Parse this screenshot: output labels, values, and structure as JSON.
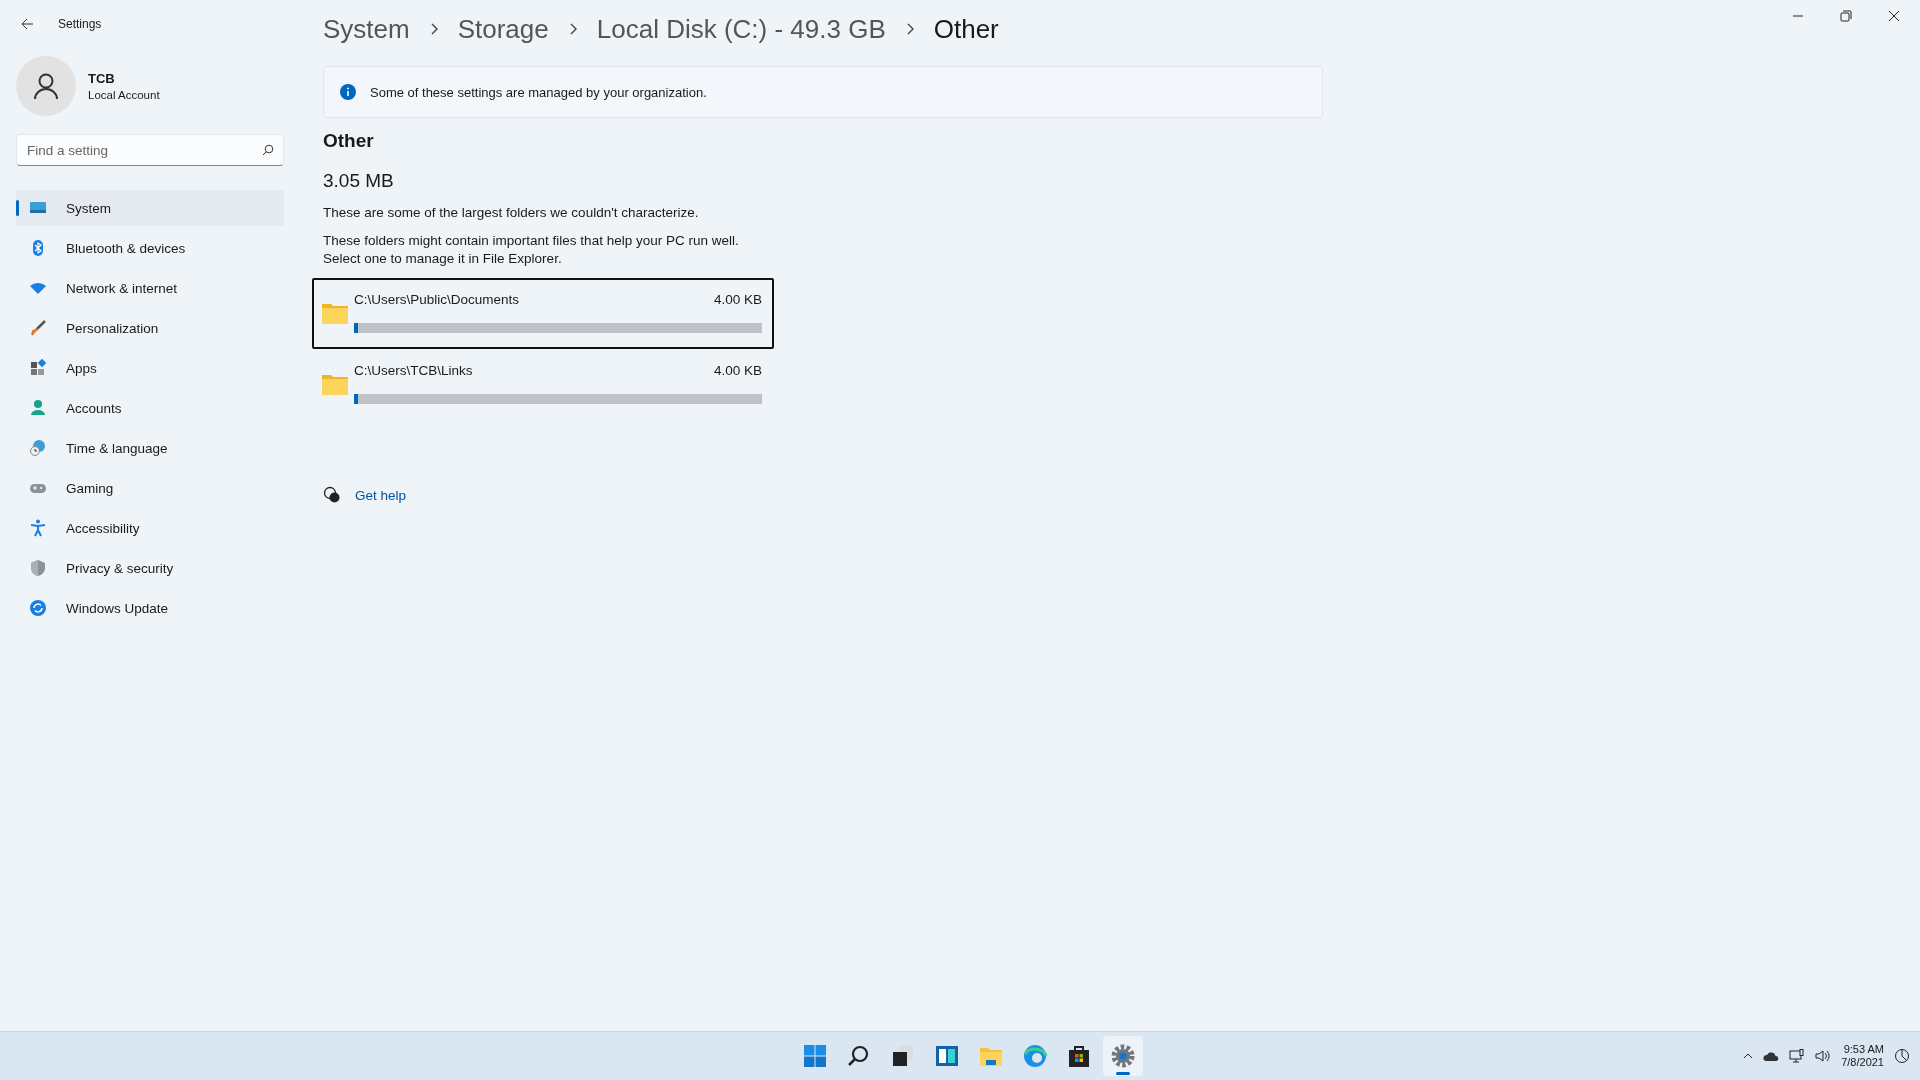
{
  "window": {
    "title": "Settings"
  },
  "account": {
    "name": "TCB",
    "type": "Local Account"
  },
  "search": {
    "placeholder": "Find a setting"
  },
  "nav": [
    {
      "label": "System",
      "kind": "system",
      "selected": true
    },
    {
      "label": "Bluetooth & devices",
      "kind": "bluetooth",
      "selected": false
    },
    {
      "label": "Network & internet",
      "kind": "network",
      "selected": false
    },
    {
      "label": "Personalization",
      "kind": "brush",
      "selected": false
    },
    {
      "label": "Apps",
      "kind": "apps",
      "selected": false
    },
    {
      "label": "Accounts",
      "kind": "accounts",
      "selected": false
    },
    {
      "label": "Time & language",
      "kind": "time",
      "selected": false
    },
    {
      "label": "Gaming",
      "kind": "gaming",
      "selected": false
    },
    {
      "label": "Accessibility",
      "kind": "accessibility",
      "selected": false
    },
    {
      "label": "Privacy & security",
      "kind": "privacy",
      "selected": false
    },
    {
      "label": "Windows Update",
      "kind": "update",
      "selected": false
    }
  ],
  "breadcrumb": [
    "System",
    "Storage",
    "Local Disk (C:) - 49.3 GB",
    "Other"
  ],
  "info_bar": "Some of these settings are managed by your organization.",
  "heading": "Other",
  "total": "3.05 MB",
  "description": "These are some of the largest folders we couldn't characterize.",
  "note_lines": [
    "These folders might contain important files that help your PC run well.",
    "Select one to manage it in File Explorer."
  ],
  "folders": [
    {
      "path": "C:\\Users\\Public\\Documents",
      "size": "4.00 KB",
      "level": 0.01,
      "selected": true
    },
    {
      "path": "C:\\Users\\TCB\\Links",
      "size": "4.00 KB",
      "level": 0.01,
      "selected": false
    }
  ],
  "help_link": "Get help",
  "taskbar": {
    "apps": [
      {
        "kind": "start",
        "active": false
      },
      {
        "kind": "search",
        "active": false
      },
      {
        "kind": "taskview",
        "active": false
      },
      {
        "kind": "widgets",
        "active": false
      },
      {
        "kind": "explorer",
        "active": false
      },
      {
        "kind": "edge",
        "active": false
      },
      {
        "kind": "store",
        "active": false
      },
      {
        "kind": "settings",
        "active": true
      }
    ],
    "time": "9:53 AM",
    "date": "7/8/2021"
  }
}
